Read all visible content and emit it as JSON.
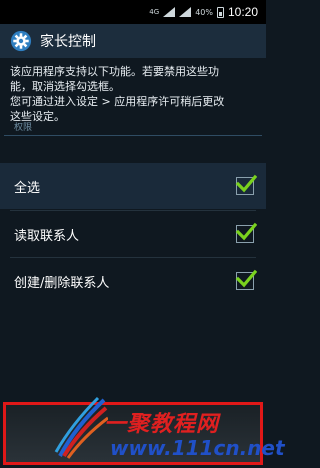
{
  "status_bar": {
    "signal_label": "4G",
    "battery_percent": "40%",
    "time": "10:20"
  },
  "action_bar": {
    "title": "家长控制",
    "icon": "gear-icon"
  },
  "intro_lines": [
    "该应用程序支持以下功能。若要禁用这些功",
    "能，取消选择勾选框。",
    "您可通过进入设定 > 应用程序许可稍后更改",
    "这些设定。"
  ],
  "section_header": "权限",
  "permissions": [
    {
      "label": "全选",
      "checked": true
    },
    {
      "label": "读取联系人",
      "checked": true
    },
    {
      "label": "创建/删除联系人",
      "checked": true
    }
  ],
  "watermark": {
    "text": "一聚教程网",
    "url": "www.111cn.net"
  },
  "colors": {
    "accent_check": "#7ad21e",
    "watermark_border": "#e01818",
    "watermark_red": "#e02020",
    "watermark_blue": "#2050c8"
  }
}
